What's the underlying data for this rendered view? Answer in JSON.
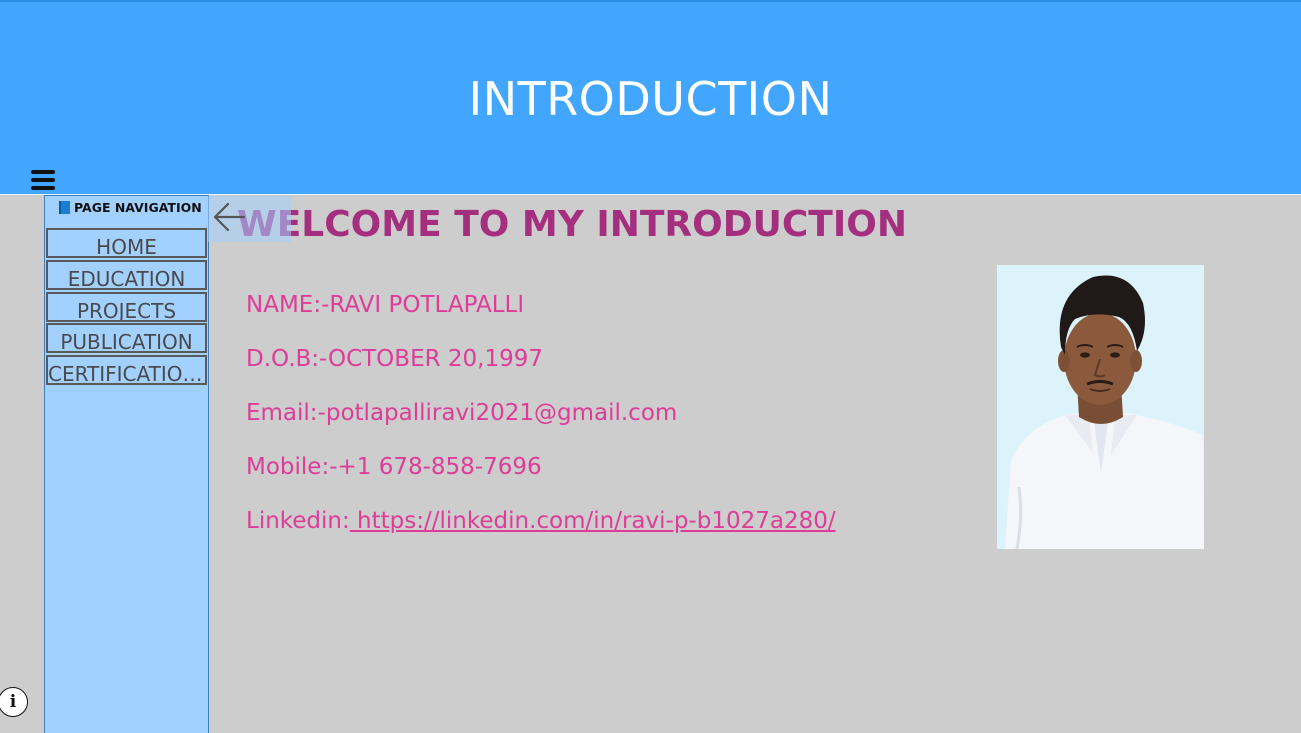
{
  "header": {
    "title": "INTRODUCTION",
    "menu_icon": "hamburger-menu-icon"
  },
  "sidebar": {
    "title": "PAGE NAVIGATION",
    "title_icon": "book-icon",
    "items": [
      {
        "label": "HOME"
      },
      {
        "label": "EDUCATION"
      },
      {
        "label": "PROJECTS"
      },
      {
        "label": "PUBLICATION"
      },
      {
        "label": "CERTIFICATIONS"
      }
    ],
    "collapse_icon": "arrow-left-icon"
  },
  "main": {
    "heading": "WELCOME TO MY INTRODUCTION",
    "details": {
      "name": "NAME:-RAVI POTLAPALLI",
      "dob": "D.O.B:-OCTOBER 20,1997",
      "email": "Email:-potlapalliravi2021@gmail.com",
      "mobile": "Mobile:-+1 678-858-7696",
      "linkedin_label": "Linkedin:",
      "linkedin_url": " https://linkedin.com/in/ravi-p-b1027a280/"
    },
    "photo_alt": "profile photo"
  },
  "info_button": {
    "label": "i",
    "icon": "info-icon"
  },
  "colors": {
    "header_bg": "#42a5fe",
    "sidebar_bg": "#a3d1ff",
    "page_bg": "#cdcdcd",
    "heading": "#a52f7f",
    "details": "#de3c98"
  }
}
